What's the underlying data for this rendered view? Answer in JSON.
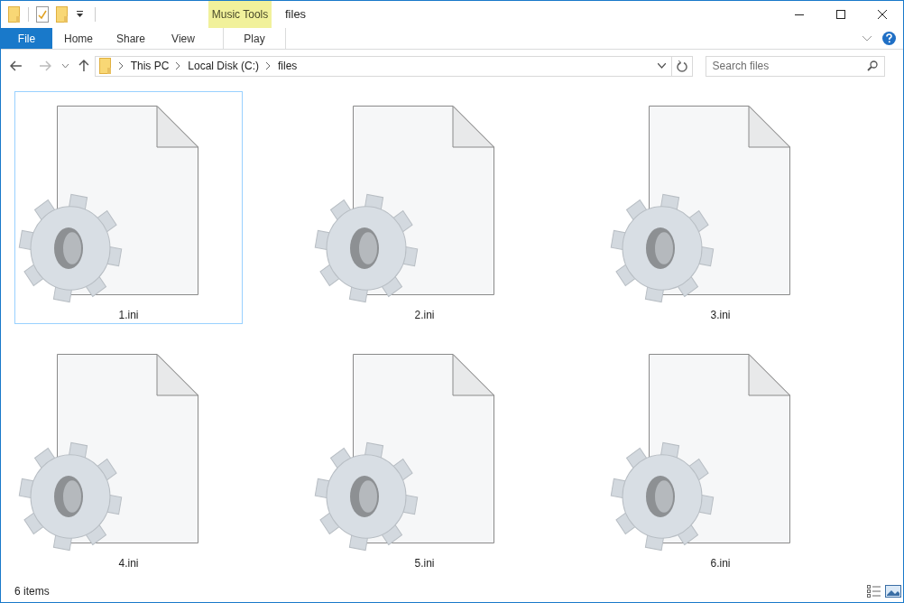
{
  "window": {
    "title": "files"
  },
  "ribbon": {
    "context_label": "Music Tools",
    "tabs": [
      {
        "label": "File",
        "kind": "file",
        "selected": false
      },
      {
        "label": "Home",
        "kind": "normal",
        "selected": false
      },
      {
        "label": "Share",
        "kind": "normal",
        "selected": false
      },
      {
        "label": "View",
        "kind": "normal",
        "selected": false
      },
      {
        "label": "Play",
        "kind": "contextual",
        "selected": false
      }
    ]
  },
  "address": {
    "path": [
      "This PC",
      "Local Disk (C:)",
      "files"
    ]
  },
  "search": {
    "placeholder": "Search files"
  },
  "files": [
    {
      "name": "1.ini",
      "focused": true
    },
    {
      "name": "2.ini",
      "focused": false
    },
    {
      "name": "3.ini",
      "focused": false
    },
    {
      "name": "4.ini",
      "focused": false
    },
    {
      "name": "5.ini",
      "focused": false
    },
    {
      "name": "6.ini",
      "focused": false
    }
  ],
  "status_bar": {
    "count": "6 items"
  }
}
